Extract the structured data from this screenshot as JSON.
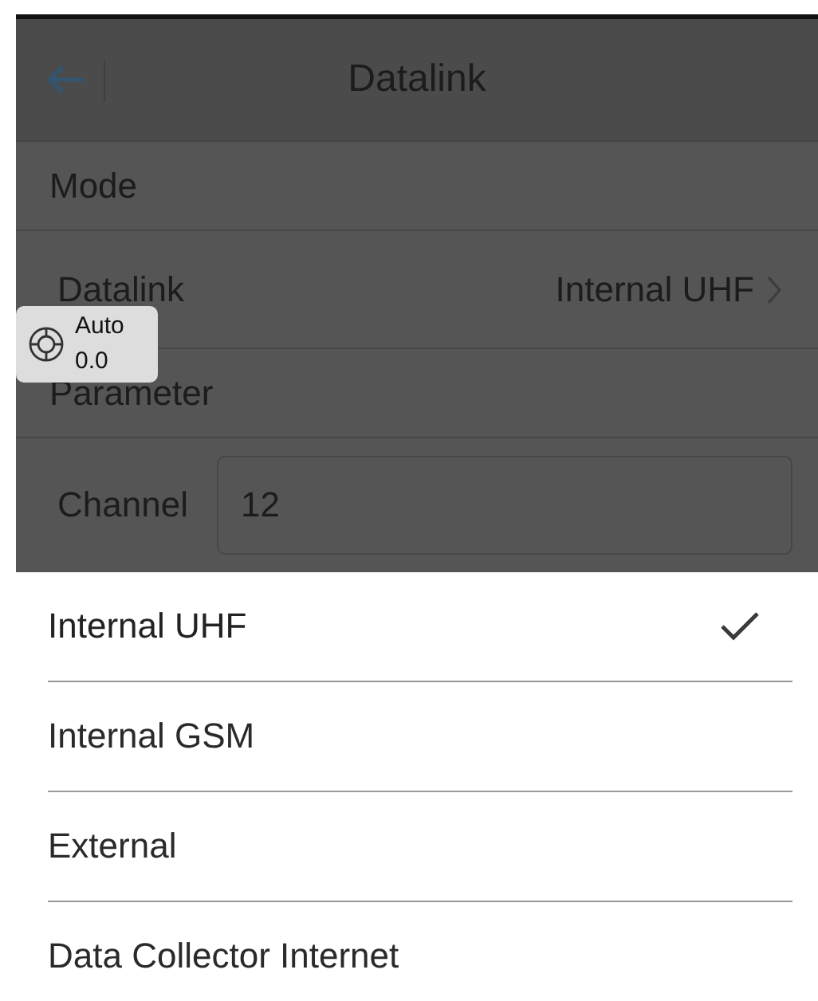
{
  "header": {
    "title": "Datalink"
  },
  "rows": [
    {
      "kind": "section",
      "label": "Mode"
    },
    {
      "kind": "select",
      "label": "Datalink",
      "value": "Internal UHF"
    },
    {
      "kind": "section",
      "label": "Parameter"
    },
    {
      "kind": "input",
      "label": "Channel",
      "value": "12"
    }
  ],
  "position_badge": {
    "mode": "Auto",
    "reading": "0.0"
  },
  "options": [
    {
      "label": "Internal UHF",
      "selected": true
    },
    {
      "label": "Internal GSM",
      "selected": false
    },
    {
      "label": "External",
      "selected": false
    },
    {
      "label": "Data Collector Internet",
      "selected": false
    }
  ]
}
